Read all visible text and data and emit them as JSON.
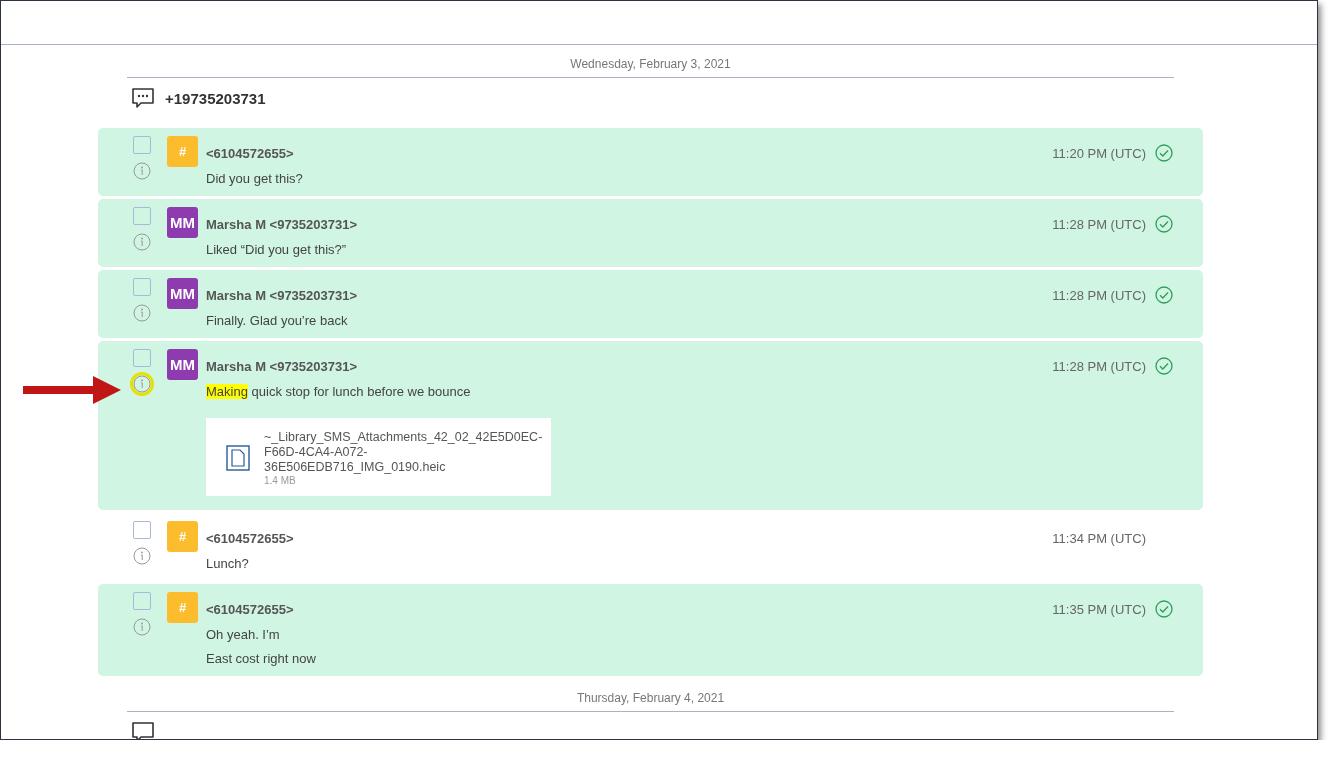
{
  "days": [
    {
      "date": "Wednesday, February 3, 2021",
      "conversation": "+19735203731",
      "messages": [
        {
          "sender": "<6104572655>",
          "avatar": {
            "kind": "hash",
            "text": "#"
          },
          "time": "11:20 PM (UTC)",
          "highlighted": true,
          "delivered": true,
          "focused": false,
          "lines": [
            [
              {
                "text": "Did you get this?",
                "marked": false
              }
            ]
          ]
        },
        {
          "sender": "Marsha M <9735203731>",
          "avatar": {
            "kind": "initials",
            "text": "MM"
          },
          "time": "11:28 PM (UTC)",
          "highlighted": true,
          "delivered": true,
          "focused": false,
          "lines": [
            [
              {
                "text": "Liked “Did you get this?”",
                "marked": false
              }
            ]
          ]
        },
        {
          "sender": "Marsha M <9735203731>",
          "avatar": {
            "kind": "initials",
            "text": "MM"
          },
          "time": "11:28 PM (UTC)",
          "highlighted": true,
          "delivered": true,
          "focused": false,
          "lines": [
            [
              {
                "text": "Finally. Glad you’re back",
                "marked": false
              }
            ]
          ]
        },
        {
          "sender": "Marsha M <9735203731>",
          "avatar": {
            "kind": "initials",
            "text": "MM"
          },
          "time": "11:28 PM (UTC)",
          "highlighted": true,
          "delivered": true,
          "focused": true,
          "lines": [
            [
              {
                "text": "Making",
                "marked": true
              },
              {
                "text": " quick stop for lunch before we bounce",
                "marked": false
              }
            ]
          ],
          "attachment": {
            "name_lines": [
              "~_Library_SMS_Attachments_42_02_42E5D0EC-",
              "F66D-4CA4-A072-",
              "36E506EDB716_IMG_0190.heic"
            ],
            "size": "1.4 MB"
          }
        },
        {
          "sender": "<6104572655>",
          "avatar": {
            "kind": "hash",
            "text": "#"
          },
          "time": "11:34 PM (UTC)",
          "highlighted": false,
          "delivered": false,
          "focused": false,
          "lines": [
            [
              {
                "text": "Lunch?",
                "marked": false
              }
            ]
          ]
        },
        {
          "sender": "<6104572655>",
          "avatar": {
            "kind": "hash",
            "text": "#"
          },
          "time": "11:35 PM (UTC)",
          "highlighted": true,
          "delivered": true,
          "focused": false,
          "lines": [
            [
              {
                "text": "Oh yeah. I’m",
                "marked": false
              }
            ],
            [
              {
                "text": "East cost right now",
                "marked": false
              }
            ]
          ]
        }
      ]
    },
    {
      "date": "Thursday, February 4, 2021"
    }
  ]
}
